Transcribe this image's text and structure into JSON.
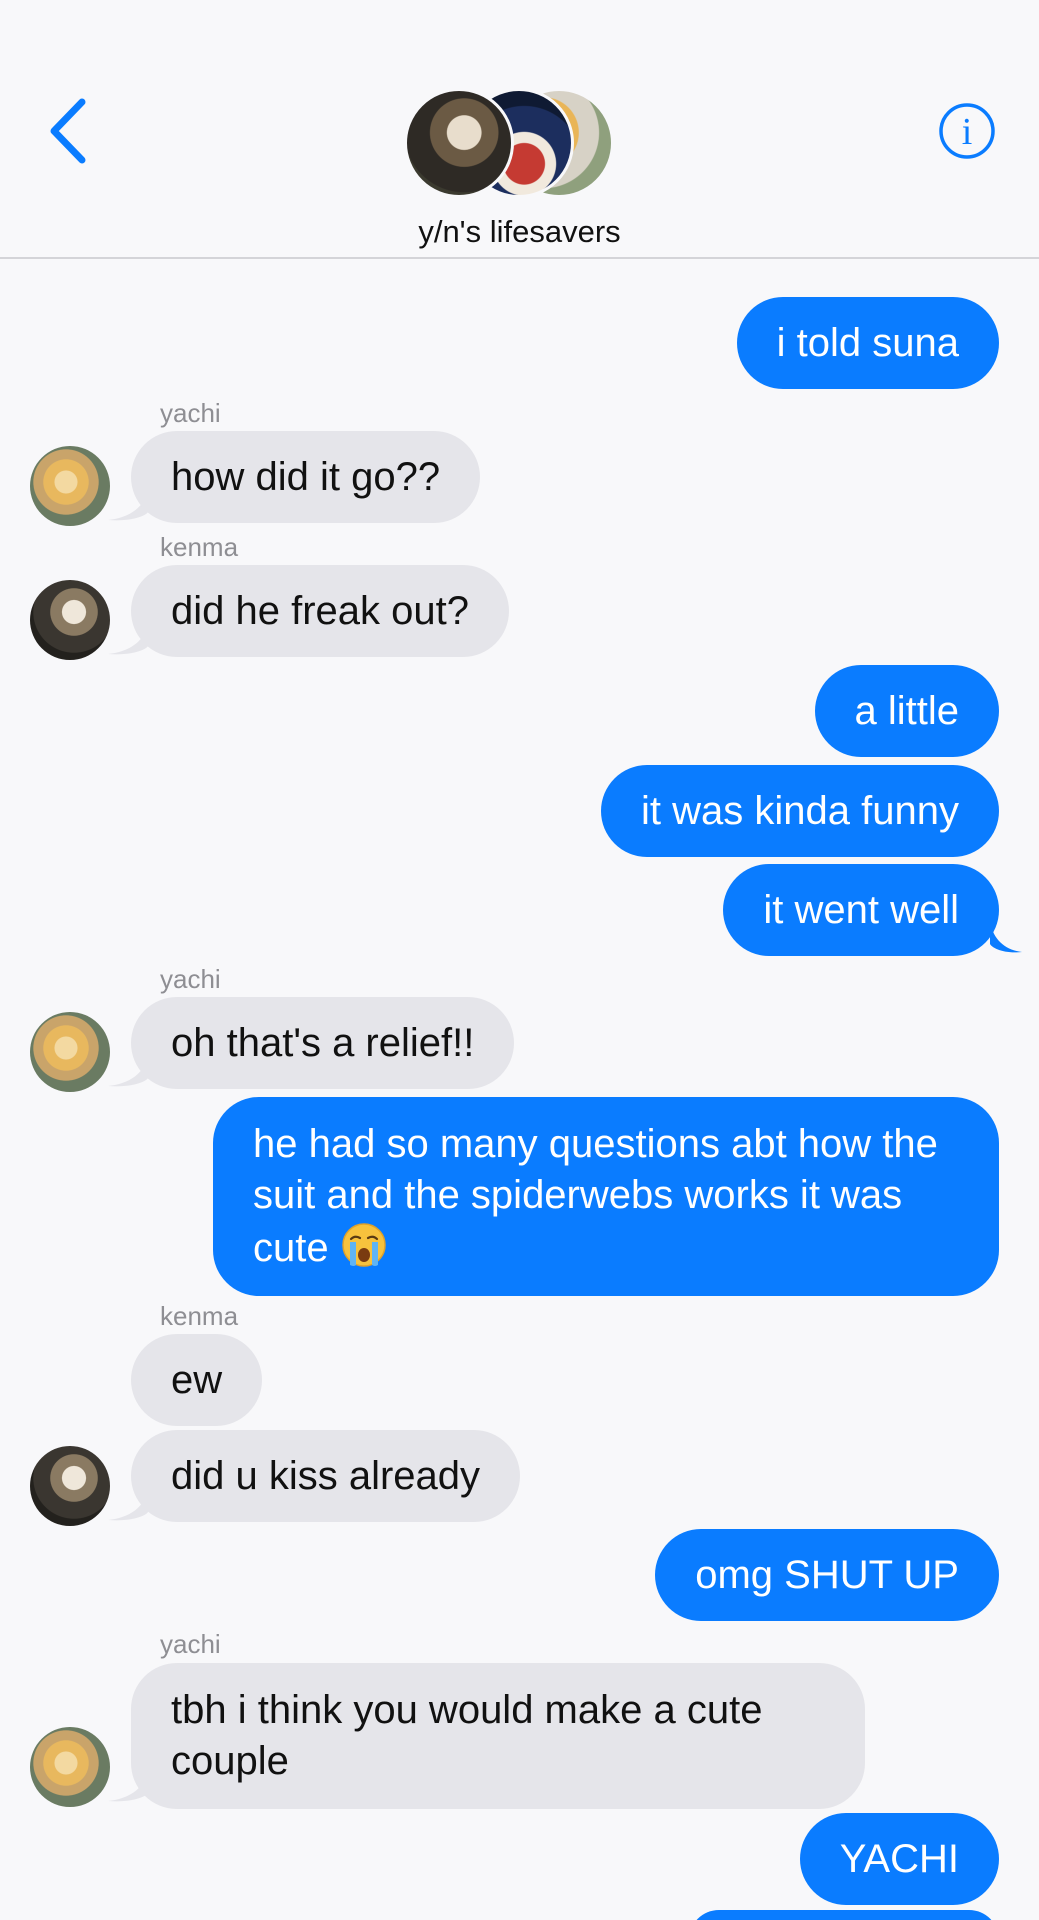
{
  "header": {
    "back_label": "back",
    "group_name": "y/n's lifesavers",
    "info_label": "i"
  },
  "messages": [
    {
      "from": "me",
      "text": "i told suna"
    },
    {
      "from": "yachi",
      "sender_label": "yachi",
      "text": "how did it go??"
    },
    {
      "from": "kenma",
      "sender_label": "kenma",
      "text": "did he freak out?"
    },
    {
      "from": "me",
      "text": "a little"
    },
    {
      "from": "me",
      "text": "it was kinda funny"
    },
    {
      "from": "me",
      "text": "it went well"
    },
    {
      "from": "yachi",
      "sender_label": "yachi",
      "text": "oh that's a relief!!"
    },
    {
      "from": "me",
      "text": "he had so many questions abt how the suit and the spiderwebs works it was cute",
      "emoji": "crying-face"
    },
    {
      "from": "kenma",
      "sender_label": "kenma",
      "text": "ew"
    },
    {
      "from": "kenma",
      "text": "did u kiss already"
    },
    {
      "from": "me",
      "text": "omg SHUT UP"
    },
    {
      "from": "yachi",
      "sender_label": "yachi",
      "text": "tbh i think you would make a cute couple"
    },
    {
      "from": "me",
      "text": "YACHI"
    }
  ],
  "colors": {
    "outgoing": "#0a7cff",
    "incoming": "#e5e5ea",
    "background": "#f8f8fa",
    "accent": "#0a7cff"
  }
}
